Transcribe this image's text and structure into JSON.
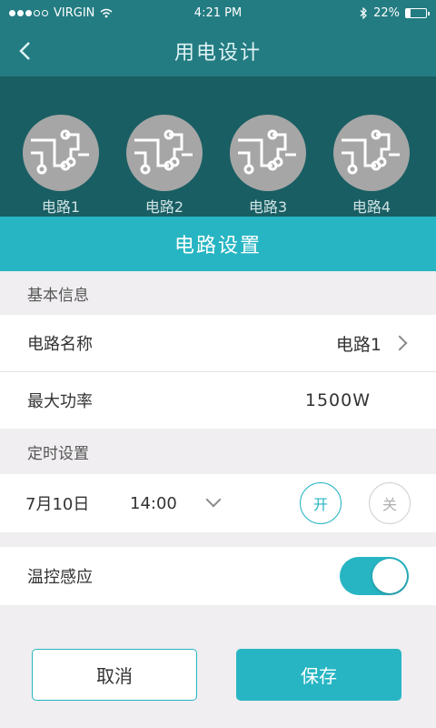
{
  "status_bar": {
    "carrier": "VIRGIN",
    "time": "4:21 PM",
    "battery": "22%",
    "battery_level": 0.22
  },
  "nav": {
    "title": "用电设计"
  },
  "circuits": [
    {
      "label": "电路1"
    },
    {
      "label": "电路2"
    },
    {
      "label": "电路3"
    },
    {
      "label": "电路4"
    }
  ],
  "sheet": {
    "title": "电路设置"
  },
  "basic": {
    "section_label": "基本信息",
    "name_label": "电路名称",
    "name_value": "电路1",
    "power_label": "最大功率",
    "power_value": "1500W"
  },
  "timer": {
    "section_label": "定时设置",
    "date": "7月10日",
    "time": "14:00",
    "on_label": "开",
    "off_label": "关"
  },
  "temp": {
    "label": "温控感应",
    "enabled": true
  },
  "actions": {
    "cancel": "取消",
    "save": "保存"
  },
  "colors": {
    "primary": "#27b5c3",
    "header_dark": "#237c82",
    "circuit_bg": "#195e63"
  }
}
